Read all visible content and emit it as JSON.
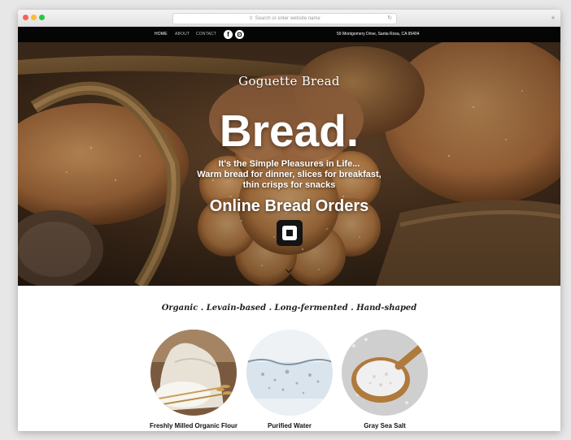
{
  "browser": {
    "url_placeholder": "Search or enter website name"
  },
  "nav": {
    "links": [
      "HOME",
      "ABOUT",
      "CONTACT"
    ],
    "address": "59 Montgomery Drive, Santa Rosa, CA 95404"
  },
  "hero": {
    "brand": "Goguette Bread",
    "headline": "Bread.",
    "tagline_lines": [
      "It's the Simple Pleasures in Life...",
      "Warm bread for dinner, slices for breakfast,",
      "thin crisps for snacks"
    ],
    "cta": "Online Bread Orders"
  },
  "features": {
    "tagline": "Organic . Levain-based . Long-fermented . Hand-shaped",
    "items": [
      {
        "caption": "Freshly Milled Organic Flour"
      },
      {
        "caption": "Purified Water"
      },
      {
        "caption": "Gray Sea Salt"
      }
    ]
  },
  "colors": {
    "nav_bg": "#050505",
    "page_bg": "#ffffff"
  }
}
